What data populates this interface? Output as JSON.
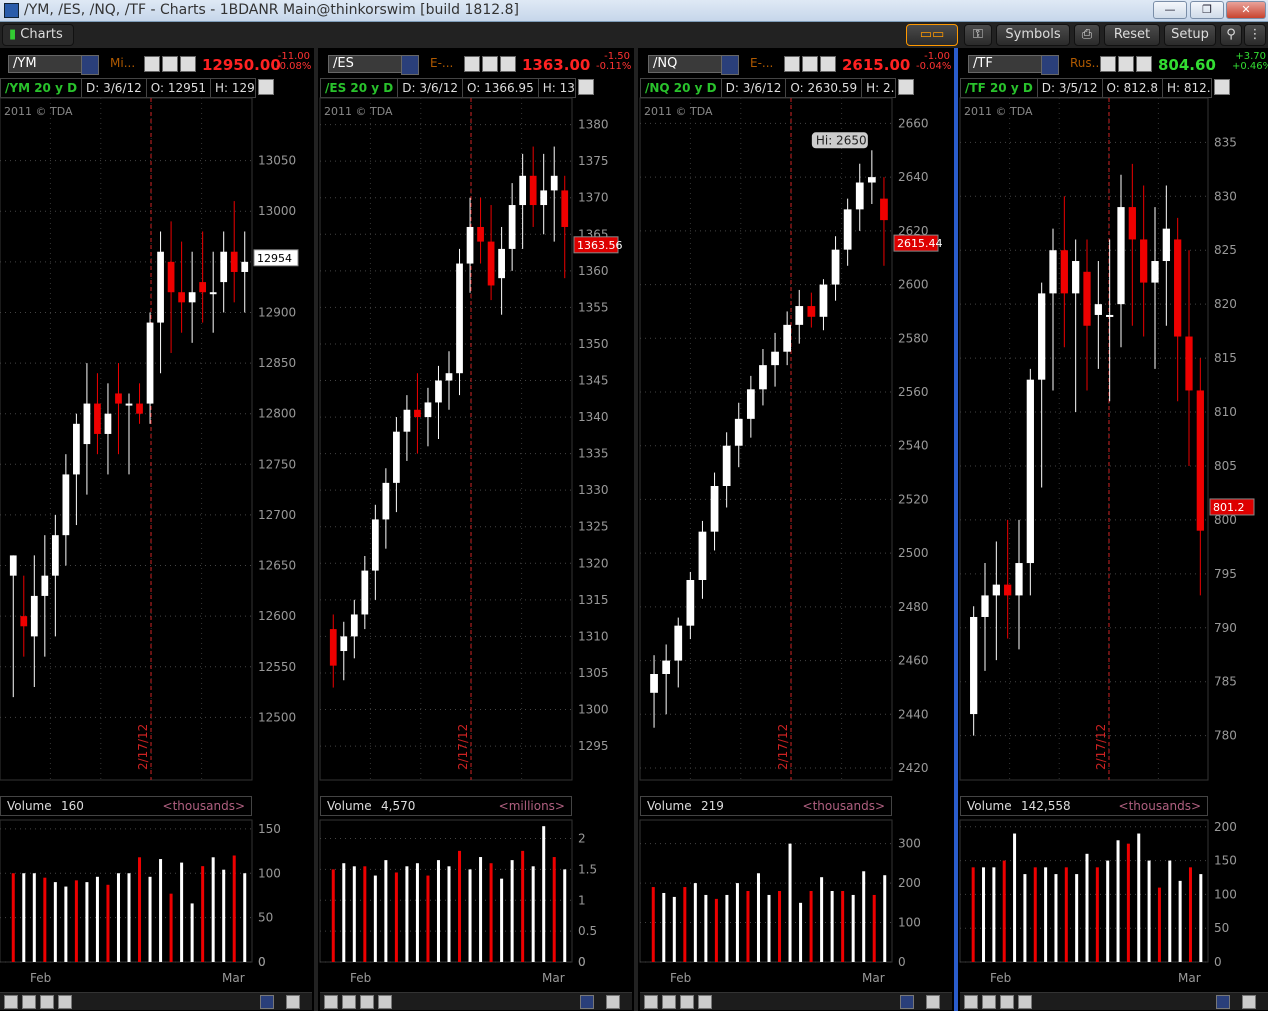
{
  "window": {
    "title": "/YM, /ES, /NQ, /TF - Charts - 1BDANR Main@thinkorswim [build 1812.8]"
  },
  "toolbar": {
    "charts_label": "Charts",
    "symbols_label": "Symbols",
    "reset_label": "Reset",
    "setup_label": "Setup"
  },
  "charts": [
    {
      "symbol": "/YM",
      "desc": "Mi...",
      "last": "12950.00",
      "chg": "-11.00",
      "pct": "-0.08%",
      "info": [
        "/YM 20 y D",
        "D: 3/6/12",
        "O: 12951",
        "H: 129..."
      ],
      "copyright": "2011 © TDA",
      "price_tag": "12954",
      "price_tag_value": 12954,
      "date_label": "2/17/12",
      "x_months": [
        "Feb",
        "Mar"
      ],
      "volume_value": "160",
      "volume_unit": "<thousands>",
      "chart_data": {
        "type": "candlestick",
        "ylim": [
          12450,
          13100
        ],
        "yticks": [
          12500,
          12550,
          12600,
          12650,
          12700,
          12750,
          12800,
          12850,
          12900,
          12950,
          13000,
          13050
        ],
        "candles": [
          [
            12640,
            12660,
            12520,
            12660
          ],
          [
            12600,
            12640,
            12560,
            12590
          ],
          [
            12580,
            12660,
            12530,
            12620
          ],
          [
            12620,
            12680,
            12560,
            12640
          ],
          [
            12640,
            12700,
            12580,
            12680
          ],
          [
            12680,
            12760,
            12650,
            12740
          ],
          [
            12740,
            12800,
            12690,
            12790
          ],
          [
            12770,
            12850,
            12720,
            12810
          ],
          [
            12810,
            12840,
            12760,
            12780
          ],
          [
            12780,
            12830,
            12740,
            12800
          ],
          [
            12820,
            12850,
            12760,
            12810
          ],
          [
            12810,
            12820,
            12740,
            12810
          ],
          [
            12810,
            12830,
            12790,
            12800
          ],
          [
            12810,
            12900,
            12790,
            12890
          ],
          [
            12890,
            12980,
            12840,
            12960
          ],
          [
            12950,
            12990,
            12860,
            12920
          ],
          [
            12920,
            12970,
            12880,
            12910
          ],
          [
            12910,
            12960,
            12870,
            12920
          ],
          [
            12930,
            12980,
            12890,
            12920
          ],
          [
            12920,
            12960,
            12880,
            12920
          ],
          [
            12930,
            12980,
            12900,
            12960
          ],
          [
            12960,
            13010,
            12910,
            12940
          ],
          [
            12940,
            12980,
            12900,
            12950
          ]
        ],
        "volume": {
          "ylim": [
            0,
            160
          ],
          "yticks": [
            0,
            50,
            100,
            150
          ],
          "values": [
            100,
            100,
            100,
            95,
            90,
            85,
            92,
            90,
            96,
            87,
            100,
            100,
            118,
            96,
            116,
            77,
            112,
            66,
            108,
            118,
            104,
            120,
            100
          ]
        }
      }
    },
    {
      "symbol": "/ES",
      "desc": "E-...",
      "last": "1363.00",
      "chg": "-1.50",
      "pct": "-0.11%",
      "info": [
        "/ES 20 y D",
        "D: 3/6/12",
        "O: 1366.95",
        "H: 13..."
      ],
      "copyright": "2011 © TDA",
      "price_tag": "1363.56",
      "price_tag_value": 1363.56,
      "date_label": "2/17/12",
      "x_months": [
        "Feb",
        "Mar"
      ],
      "volume_value": "4,570",
      "volume_unit": "<millions>",
      "chart_data": {
        "type": "candlestick",
        "ylim": [
          1292,
          1382
        ],
        "yticks": [
          1295,
          1300,
          1305,
          1310,
          1315,
          1320,
          1325,
          1330,
          1335,
          1340,
          1345,
          1350,
          1355,
          1360,
          1365,
          1370,
          1375,
          1380
        ],
        "candles": [
          [
            1311,
            1313,
            1303,
            1306
          ],
          [
            1308,
            1312,
            1304,
            1310
          ],
          [
            1310,
            1315,
            1307,
            1313
          ],
          [
            1313,
            1321,
            1311,
            1319
          ],
          [
            1319,
            1328,
            1315,
            1326
          ],
          [
            1326,
            1333,
            1322,
            1331
          ],
          [
            1331,
            1340,
            1327,
            1338
          ],
          [
            1338,
            1343,
            1334,
            1341
          ],
          [
            1341,
            1346,
            1335,
            1340
          ],
          [
            1340,
            1344,
            1336,
            1342
          ],
          [
            1342,
            1347,
            1337,
            1345
          ],
          [
            1345,
            1349,
            1341,
            1346
          ],
          [
            1346,
            1363,
            1343,
            1361
          ],
          [
            1361,
            1370,
            1357,
            1366
          ],
          [
            1366,
            1370,
            1361,
            1364
          ],
          [
            1364,
            1369,
            1356,
            1358
          ],
          [
            1359,
            1366,
            1354,
            1363
          ],
          [
            1363,
            1372,
            1360,
            1369
          ],
          [
            1369,
            1376,
            1363,
            1373
          ],
          [
            1373,
            1377,
            1366,
            1369
          ],
          [
            1369,
            1376,
            1365,
            1371
          ],
          [
            1371,
            1377,
            1364,
            1373
          ],
          [
            1371,
            1373,
            1359,
            1366
          ]
        ],
        "volume": {
          "ylim": [
            0,
            2.3
          ],
          "yticks": [
            0,
            0.5,
            1,
            1.5,
            2
          ],
          "values": [
            1.5,
            1.6,
            1.55,
            1.55,
            1.4,
            1.65,
            1.45,
            1.55,
            1.6,
            1.4,
            1.65,
            1.55,
            1.8,
            1.5,
            1.7,
            1.6,
            1.35,
            1.65,
            1.8,
            1.55,
            2.2,
            1.7,
            1.5
          ]
        }
      }
    },
    {
      "symbol": "/NQ",
      "desc": "E-...",
      "last": "2615.00",
      "chg": "-1.00",
      "pct": "-0.04%",
      "info": [
        "/NQ 20 y D",
        "D: 3/6/12",
        "O: 2630.59",
        "H: 2..."
      ],
      "copyright": "2011 © TDA",
      "price_tag": "2615.44",
      "price_tag_value": 2615.44,
      "hi_label": "Hi: 2650",
      "hi_value": 2650,
      "date_label": "2/17/12",
      "x_months": [
        "Feb",
        "Mar"
      ],
      "volume_value": "219",
      "volume_unit": "<thousands>",
      "chart_data": {
        "type": "candlestick",
        "ylim": [
          2420,
          2665
        ],
        "yticks": [
          2420,
          2440,
          2460,
          2480,
          2500,
          2520,
          2540,
          2560,
          2580,
          2600,
          2620,
          2640,
          2660
        ],
        "candles": [
          [
            2448,
            2462,
            2435,
            2455
          ],
          [
            2455,
            2466,
            2440,
            2460
          ],
          [
            2460,
            2476,
            2450,
            2473
          ],
          [
            2473,
            2493,
            2468,
            2490
          ],
          [
            2490,
            2512,
            2483,
            2508
          ],
          [
            2508,
            2530,
            2501,
            2525
          ],
          [
            2525,
            2545,
            2517,
            2540
          ],
          [
            2540,
            2556,
            2532,
            2550
          ],
          [
            2550,
            2566,
            2543,
            2561
          ],
          [
            2561,
            2576,
            2555,
            2570
          ],
          [
            2570,
            2582,
            2562,
            2575
          ],
          [
            2575,
            2590,
            2570,
            2585
          ],
          [
            2585,
            2598,
            2578,
            2592
          ],
          [
            2592,
            2597,
            2584,
            2588
          ],
          [
            2588,
            2602,
            2583,
            2600
          ],
          [
            2600,
            2618,
            2594,
            2613
          ],
          [
            2613,
            2632,
            2607,
            2628
          ],
          [
            2628,
            2645,
            2620,
            2638
          ],
          [
            2638,
            2650,
            2630,
            2640
          ],
          [
            2632,
            2640,
            2607,
            2624
          ]
        ],
        "volume": {
          "ylim": [
            0,
            360
          ],
          "yticks": [
            100,
            200,
            300
          ],
          "values": [
            190,
            175,
            165,
            190,
            200,
            170,
            160,
            170,
            200,
            180,
            225,
            170,
            180,
            300,
            150,
            180,
            215,
            180,
            180,
            170,
            230,
            170,
            220
          ]
        }
      }
    },
    {
      "symbol": "/TF",
      "desc": "Rus...",
      "last": "804.60",
      "chg": "+3.70",
      "pct": "+0.46%",
      "info": [
        "/TF 20 y D",
        "D: 3/5/12",
        "O: 812.8",
        "H: 812.8"
      ],
      "copyright": "2011 © TDA",
      "price_tag": "801.2",
      "price_tag_value": 801.2,
      "date_label": "2/17/12",
      "x_months": [
        "Feb",
        "Mar"
      ],
      "volume_value": "142,558",
      "volume_unit": "<thousands>",
      "chart_data": {
        "type": "candlestick",
        "ylim": [
          777,
          838
        ],
        "yticks": [
          780,
          785,
          790,
          795,
          800,
          805,
          810,
          815,
          820,
          825,
          830,
          835
        ],
        "candles": [
          [
            782,
            792,
            780,
            791
          ],
          [
            791,
            796,
            786,
            793
          ],
          [
            793,
            798,
            787,
            794
          ],
          [
            794,
            800,
            789,
            793
          ],
          [
            793,
            800,
            788,
            796
          ],
          [
            796,
            814,
            793,
            813
          ],
          [
            813,
            822,
            803,
            821
          ],
          [
            821,
            827,
            812,
            825
          ],
          [
            825,
            830,
            816,
            821
          ],
          [
            821,
            826,
            810,
            824
          ],
          [
            823,
            826,
            812,
            818
          ],
          [
            819,
            824,
            814,
            820
          ],
          [
            819,
            826,
            811,
            819
          ],
          [
            820,
            832,
            816,
            829
          ],
          [
            829,
            833,
            818,
            826
          ],
          [
            826,
            831,
            817,
            822
          ],
          [
            822,
            829,
            814,
            824
          ],
          [
            824,
            831,
            818,
            827
          ],
          [
            826,
            828,
            811,
            817
          ],
          [
            817,
            825,
            805,
            812
          ],
          [
            812,
            815,
            793,
            799
          ]
        ],
        "volume": {
          "ylim": [
            0,
            210
          ],
          "yticks": [
            50,
            100,
            150,
            200
          ],
          "values": [
            140,
            140,
            140,
            150,
            190,
            130,
            140,
            140,
            130,
            140,
            130,
            160,
            140,
            150,
            180,
            175,
            190,
            150,
            110,
            150,
            120,
            140,
            130
          ]
        }
      }
    }
  ]
}
